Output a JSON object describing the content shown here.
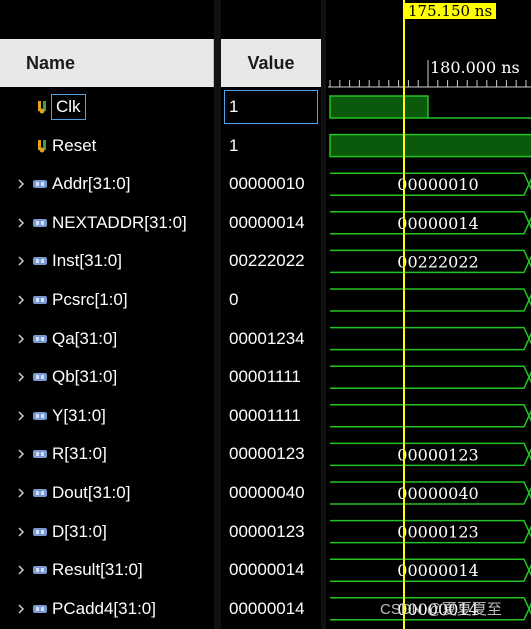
{
  "header": {
    "name_label": "Name",
    "value_label": "Value"
  },
  "timeline": {
    "cursor_time": "175.150 ns",
    "tick_time": "180.000 ns"
  },
  "signals": [
    {
      "name": "Clk",
      "value": "1",
      "type": "bit",
      "selected": true
    },
    {
      "name": "Reset",
      "value": "1",
      "type": "bit"
    },
    {
      "name": "Addr[31:0]",
      "value": "00000010",
      "type": "bus",
      "wave": "00000010"
    },
    {
      "name": "NEXTADDR[31:0]",
      "value": "00000014",
      "type": "bus",
      "wave": "00000014"
    },
    {
      "name": "Inst[31:0]",
      "value": "00222022",
      "type": "bus",
      "wave": "00222022"
    },
    {
      "name": "Pcsrc[1:0]",
      "value": "0",
      "type": "bus",
      "wave": ""
    },
    {
      "name": "Qa[31:0]",
      "value": "00001234",
      "type": "bus",
      "wave": ""
    },
    {
      "name": "Qb[31:0]",
      "value": "00001111",
      "type": "bus",
      "wave": ""
    },
    {
      "name": "Y[31:0]",
      "value": "00001111",
      "type": "bus",
      "wave": ""
    },
    {
      "name": "R[31:0]",
      "value": "00000123",
      "type": "bus",
      "wave": "00000123"
    },
    {
      "name": "Dout[31:0]",
      "value": "00000040",
      "type": "bus",
      "wave": "00000040"
    },
    {
      "name": "D[31:0]",
      "value": "00000123",
      "type": "bus",
      "wave": "00000123"
    },
    {
      "name": "Result[31:0]",
      "value": "00000014",
      "type": "bus",
      "wave": "00000014"
    },
    {
      "name": "PCadd4[31:0]",
      "value": "00000014",
      "type": "bus",
      "wave": "00000014"
    }
  ],
  "watermark": "CSDN @夏夏夏至",
  "colors": {
    "wave_green": "#22c322",
    "wave_fill": "#0b5a0b",
    "cursor": "#ffff00",
    "selection": "#4aa3e6"
  }
}
